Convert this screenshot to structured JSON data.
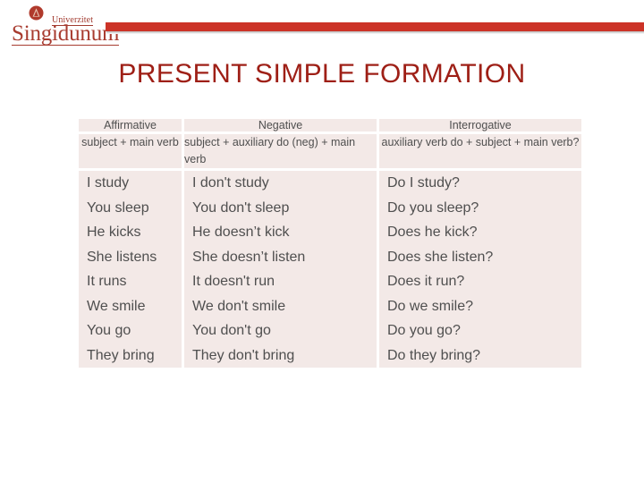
{
  "header": {
    "logo": {
      "emblem_icon": "university-crest-icon",
      "line1": "Univerzitet",
      "line2": "Singidunum",
      "brand_color": "#a83c30"
    },
    "bar_color": "#cc3327"
  },
  "title": "PRESENT SIMPLE FORMATION",
  "title_color": "#9e1f16",
  "table": {
    "columns": [
      "Affirmative",
      "Negative",
      "Interrogative"
    ],
    "formulas": [
      "subject + main verb",
      "subject + auxiliary do (neg) + main verb",
      "auxiliary verb do + subject + main verb?"
    ],
    "examples": {
      "affirmative": [
        "I study",
        "You sleep",
        "He kicks",
        "She listens",
        "It runs",
        "We smile",
        "You go",
        "They bring"
      ],
      "negative": [
        "I don't study",
        "You don't sleep",
        "He doesn’t kick",
        "She doesn’t listen",
        "It doesn't run",
        "We don't smile",
        "You don't go",
        "They don't bring"
      ],
      "interrogative": [
        "Do I study?",
        "Do you sleep?",
        "Does he kick?",
        "Does she listen?",
        "Does it run?",
        "Do we smile?",
        "Do you go?",
        "Do they bring?"
      ]
    },
    "cell_bg": "#f3e9e7",
    "header_bg": "#f6eeec"
  }
}
